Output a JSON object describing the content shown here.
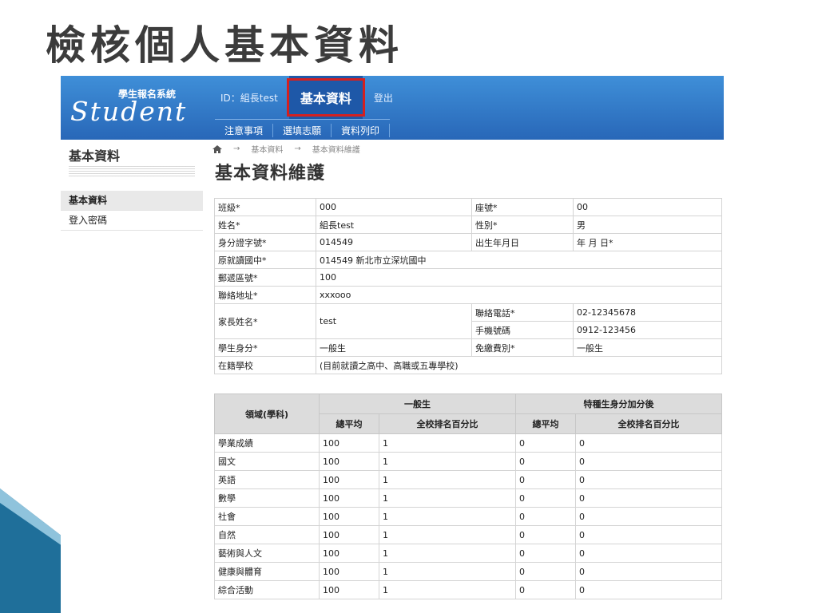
{
  "slide": {
    "title": "檢核個人基本資料"
  },
  "header": {
    "logo_sub": "學生報名系統",
    "logo": "Student",
    "top_nav": [
      {
        "label": "ID：組長test",
        "selected": false
      },
      {
        "label": "基本資料",
        "selected": true
      },
      {
        "label": "登出",
        "selected": false
      }
    ],
    "sub_nav": [
      "注意事項",
      "選填志願",
      "資料列印"
    ]
  },
  "sidebar": {
    "title": "基本資料",
    "items": [
      {
        "label": "基本資料",
        "active": true
      },
      {
        "label": "登入密碼",
        "active": false
      }
    ]
  },
  "breadcrumb": [
    "基本資料",
    "基本資料維護"
  ],
  "page_title": "基本資料維護",
  "info": {
    "class_label": "班級*",
    "class_value": "000",
    "seat_label": "座號*",
    "seat_value": "00",
    "name_label": "姓名*",
    "name_value": "組長test",
    "gender_label": "性別*",
    "gender_value": "男",
    "id_label": "身分證字號*",
    "id_value": "014549",
    "birth_label": "出生年月日",
    "birth_value": "年 月 日*",
    "school_label": "原就讀國中*",
    "school_value": "014549 新北市立深坑國中",
    "zip_label": "郵遞區號*",
    "zip_value": "100",
    "addr_label": "聯絡地址*",
    "addr_value": "xxxooo",
    "parent_label": "家長姓名*",
    "parent_value": "test",
    "phone_label": "聯絡電話*",
    "phone_value": "02-12345678",
    "mobile_label": "手機號碼",
    "mobile_value": "0912-123456",
    "status_label": "學生身分*",
    "status_value": "一般生",
    "fee_label": "免繳費別*",
    "fee_value": "一般生",
    "enroll_label": "在籍學校",
    "enroll_value": "(目前就讀之高中、高職或五專學校)"
  },
  "scores": {
    "header_domain": "領域(學科)",
    "header_general": "一般生",
    "header_special": "特種生身分加分後",
    "header_avg": "總平均",
    "header_rank": "全校排名百分比",
    "rows": [
      {
        "subject": "學業成績",
        "g_avg": "100",
        "g_rank": "1",
        "s_avg": "0",
        "s_rank": "0"
      },
      {
        "subject": "國文",
        "g_avg": "100",
        "g_rank": "1",
        "s_avg": "0",
        "s_rank": "0"
      },
      {
        "subject": "英語",
        "g_avg": "100",
        "g_rank": "1",
        "s_avg": "0",
        "s_rank": "0"
      },
      {
        "subject": "數學",
        "g_avg": "100",
        "g_rank": "1",
        "s_avg": "0",
        "s_rank": "0"
      },
      {
        "subject": "社會",
        "g_avg": "100",
        "g_rank": "1",
        "s_avg": "0",
        "s_rank": "0"
      },
      {
        "subject": "自然",
        "g_avg": "100",
        "g_rank": "1",
        "s_avg": "0",
        "s_rank": "0"
      },
      {
        "subject": "藝術與人文",
        "g_avg": "100",
        "g_rank": "1",
        "s_avg": "0",
        "s_rank": "0"
      },
      {
        "subject": "健康與體育",
        "g_avg": "100",
        "g_rank": "1",
        "s_avg": "0",
        "s_rank": "0"
      },
      {
        "subject": "綜合活動",
        "g_avg": "100",
        "g_rank": "1",
        "s_avg": "0",
        "s_rank": "0"
      }
    ]
  },
  "colors": {
    "header_blue": "#2f77c8",
    "highlight_red": "#d42020",
    "deco_teal": "#1f6f9a"
  }
}
